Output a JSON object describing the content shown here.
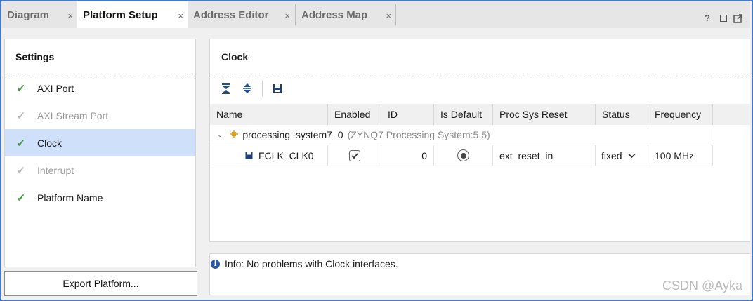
{
  "tabs": [
    {
      "label": "Diagram",
      "active": false
    },
    {
      "label": "Platform Setup",
      "active": true
    },
    {
      "label": "Address Editor",
      "active": false
    },
    {
      "label": "Address Map",
      "active": false
    }
  ],
  "tab_close_glyph": "×",
  "window_controls": {
    "help": "?",
    "restore": "restore-icon",
    "float": "float-icon"
  },
  "settings": {
    "title": "Settings",
    "steps": [
      {
        "label": "AXI Port",
        "checked": true,
        "active": false
      },
      {
        "label": "AXI Stream Port",
        "checked": false,
        "active": false
      },
      {
        "label": "Clock",
        "checked": true,
        "active": true
      },
      {
        "label": "Interrupt",
        "checked": false,
        "active": false
      },
      {
        "label": "Platform Name",
        "checked": true,
        "active": false
      }
    ],
    "check_glyph": "✓"
  },
  "export_button": "Export Platform...",
  "clock": {
    "title": "Clock",
    "toolbar": [
      "collapse-all-icon",
      "expand-all-icon",
      "save-icon"
    ],
    "columns": [
      "Name",
      "Enabled",
      "ID",
      "Is Default",
      "Proc Sys Reset",
      "Status",
      "Frequency"
    ],
    "group": {
      "name": "processing_system7_0",
      "detail": "(ZYNQ7 Processing System:5.5)"
    },
    "rows": [
      {
        "name": "FCLK_CLK0",
        "enabled": true,
        "id": "0",
        "is_default": true,
        "proc_sys_reset": "ext_reset_in",
        "status": "fixed",
        "frequency": "100 MHz"
      }
    ]
  },
  "info": {
    "text": "Info: No problems with Clock interfaces."
  },
  "watermark": "CSDN @Ayka",
  "colors": {
    "active_step": "#cfe0fb",
    "check_green": "#3f9a3f",
    "border_blue": "#4a78c0",
    "info_blue": "#2d5aa8"
  }
}
